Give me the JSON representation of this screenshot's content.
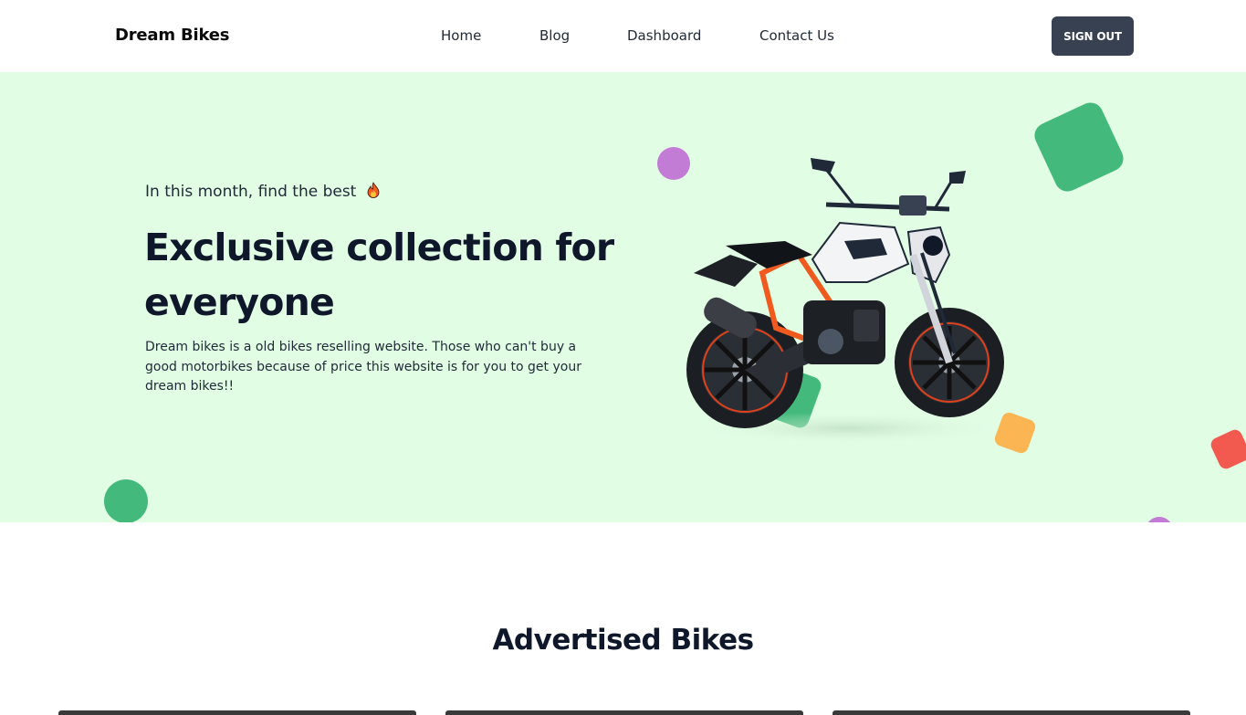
{
  "navbar": {
    "brand": "Dream Bikes",
    "links": [
      "Home",
      "Blog",
      "Dashboard",
      "Contact Us"
    ],
    "signout_label": "SIGN OUT"
  },
  "hero": {
    "subtitle": "In this month, find the best",
    "subtitle_icon": "fire-icon",
    "headline_line1": "Exclusive collection for",
    "headline_line2": "everyone",
    "description": "Dream bikes is a old bikes reselling website. Those who can't buy a good motorbikes because of price this website is for you to get your dream bikes!!",
    "background_color": "#e1fde4",
    "shape_colors": [
      "#43b97c",
      "#c27cd6",
      "#fbb552",
      "#f25a4f"
    ]
  },
  "advertised": {
    "title": "Advertised Bikes"
  }
}
